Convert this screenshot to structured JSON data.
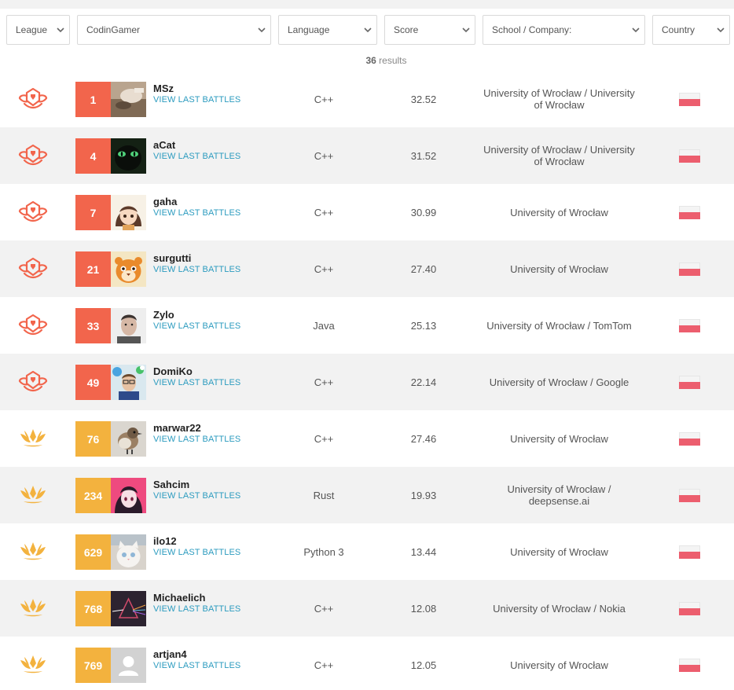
{
  "filters": [
    {
      "label": "League"
    },
    {
      "label": "CodinGamer"
    },
    {
      "label": "Language"
    },
    {
      "label": "Score"
    },
    {
      "label": "School / Company:"
    },
    {
      "label": "Country"
    }
  ],
  "results": {
    "count": "36",
    "suffix": "results"
  },
  "view_last_battles": "VIEW LAST BATTLES",
  "colors": {
    "legend_red": "#f2654c",
    "gold_orange": "#f3b23e",
    "link": "#2b9bbf",
    "row_alt": "#f2f2f2"
  },
  "rows": [
    {
      "league": "legend",
      "rank": "1",
      "name": "MSz",
      "language": "C++",
      "score": "32.52",
      "school": "University of Wrocław / University of Wrocław",
      "country": "Poland",
      "avatar": "photo"
    },
    {
      "league": "legend",
      "rank": "4",
      "name": "aCat",
      "language": "C++",
      "score": "31.52",
      "school": "University of Wrocław / University of Wrocław",
      "country": "Poland",
      "avatar": "black-cat"
    },
    {
      "league": "legend",
      "rank": "7",
      "name": "gaha",
      "language": "C++",
      "score": "30.99",
      "school": "University of Wrocław",
      "country": "Poland",
      "avatar": "anime-girl"
    },
    {
      "league": "legend",
      "rank": "21",
      "name": "surgutti",
      "language": "C++",
      "score": "27.40",
      "school": "University of Wrocław",
      "country": "Poland",
      "avatar": "tiger"
    },
    {
      "league": "legend",
      "rank": "33",
      "name": "Zylo",
      "language": "Java",
      "score": "25.13",
      "school": "University of Wrocław / TomTom",
      "country": "Poland",
      "avatar": "man-portrait"
    },
    {
      "league": "legend",
      "rank": "49",
      "name": "DomiKo",
      "language": "C++",
      "score": "22.14",
      "school": "University of Wrocław / Google",
      "country": "Poland",
      "avatar": "man-balloons"
    },
    {
      "league": "gold",
      "rank": "76",
      "name": "marwar22",
      "language": "C++",
      "score": "27.46",
      "school": "University of Wrocław",
      "country": "Poland",
      "avatar": "sparrow"
    },
    {
      "league": "gold",
      "rank": "234",
      "name": "Sahcim",
      "language": "Rust",
      "score": "19.93",
      "school": "University of Wrocław / deepsense.ai",
      "country": "Poland",
      "avatar": "anime-pink"
    },
    {
      "league": "gold",
      "rank": "629",
      "name": "ilo12",
      "language": "Python 3",
      "score": "13.44",
      "school": "University of Wrocław",
      "country": "Poland",
      "avatar": "white-cat"
    },
    {
      "league": "gold",
      "rank": "768",
      "name": "Michaelich",
      "language": "C++",
      "score": "12.08",
      "school": "University of Wrocław / Nokia",
      "country": "Poland",
      "avatar": "prism"
    },
    {
      "league": "gold",
      "rank": "769",
      "name": "artjan4",
      "language": "C++",
      "score": "12.05",
      "school": "University of Wrocław",
      "country": "Poland",
      "avatar": "default-user"
    }
  ]
}
